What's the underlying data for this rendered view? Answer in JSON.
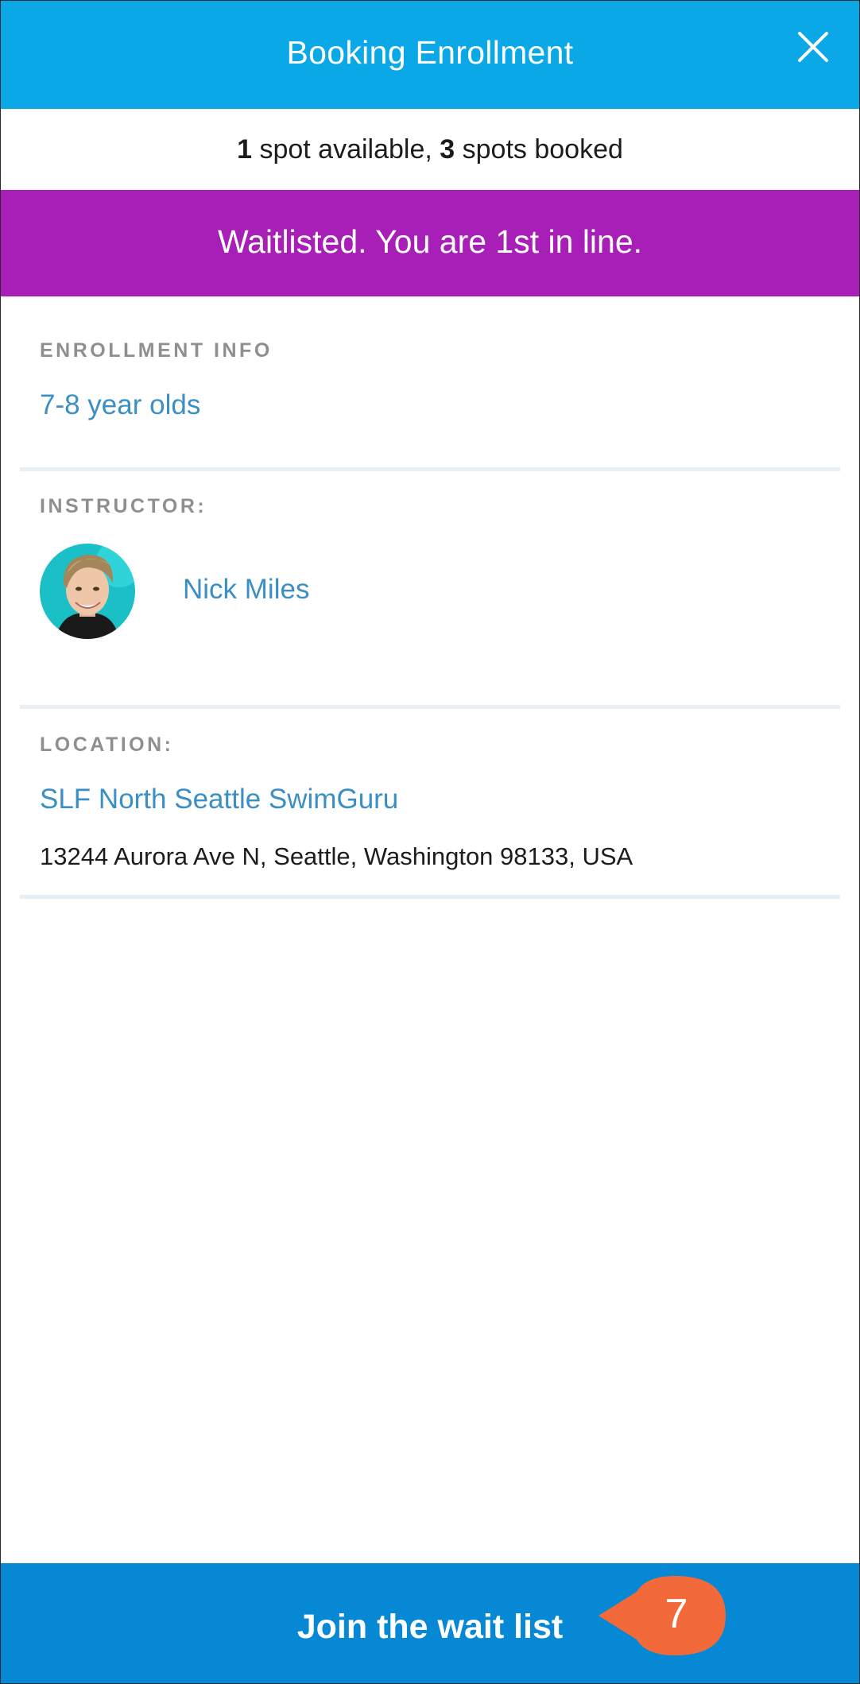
{
  "header": {
    "title": "Booking Enrollment",
    "close_icon": "close-icon"
  },
  "availability": {
    "available_count": "1",
    "available_label": " spot available, ",
    "booked_count": "3",
    "booked_label": " spots booked"
  },
  "status_banner": {
    "text": "Waitlisted. You are 1st in line.",
    "color": "#a81fb7"
  },
  "enrollment": {
    "label": "ENROLLMENT INFO",
    "group": "7-8 year olds"
  },
  "instructor": {
    "label": "INSTRUCTOR:",
    "name": "Nick Miles"
  },
  "location": {
    "label": "LOCATION:",
    "name": "SLF North Seattle SwimGuru",
    "address": "13244 Aurora Ave N, Seattle, Washington 98133, USA"
  },
  "footer": {
    "button_label": "Join the wait list",
    "step_badge": "7"
  },
  "colors": {
    "header": "#0aa8e6",
    "footer": "#0688d4",
    "link": "#3b8fc4",
    "badge": "#f26a3a"
  }
}
